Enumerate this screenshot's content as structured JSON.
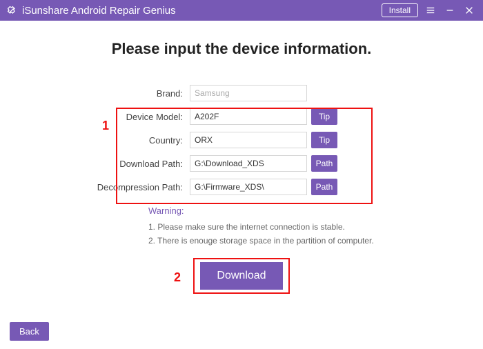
{
  "titlebar": {
    "app_name": "iSunshare Android Repair Genius",
    "install_label": "Install"
  },
  "heading": "Please input the device information.",
  "form": {
    "brand": {
      "label": "Brand:",
      "value": "Samsung"
    },
    "model": {
      "label": "Device Model:",
      "value": "A202F",
      "btn": "Tip"
    },
    "country": {
      "label": "Country:",
      "value": "ORX",
      "btn": "Tip"
    },
    "download_path": {
      "label": "Download Path:",
      "value": "G:\\Download_XDS",
      "btn": "Path"
    },
    "decompression_path": {
      "label": "Decompression Path:",
      "value": "G:\\Firmware_XDS\\",
      "btn": "Path"
    }
  },
  "warning": {
    "title": "Warning:",
    "line1": "1. Please make sure the internet connection is stable.",
    "line2": "2. There is enouge storage space in the partition of computer."
  },
  "callouts": {
    "one": "1",
    "two": "2"
  },
  "buttons": {
    "download": "Download",
    "back": "Back"
  }
}
